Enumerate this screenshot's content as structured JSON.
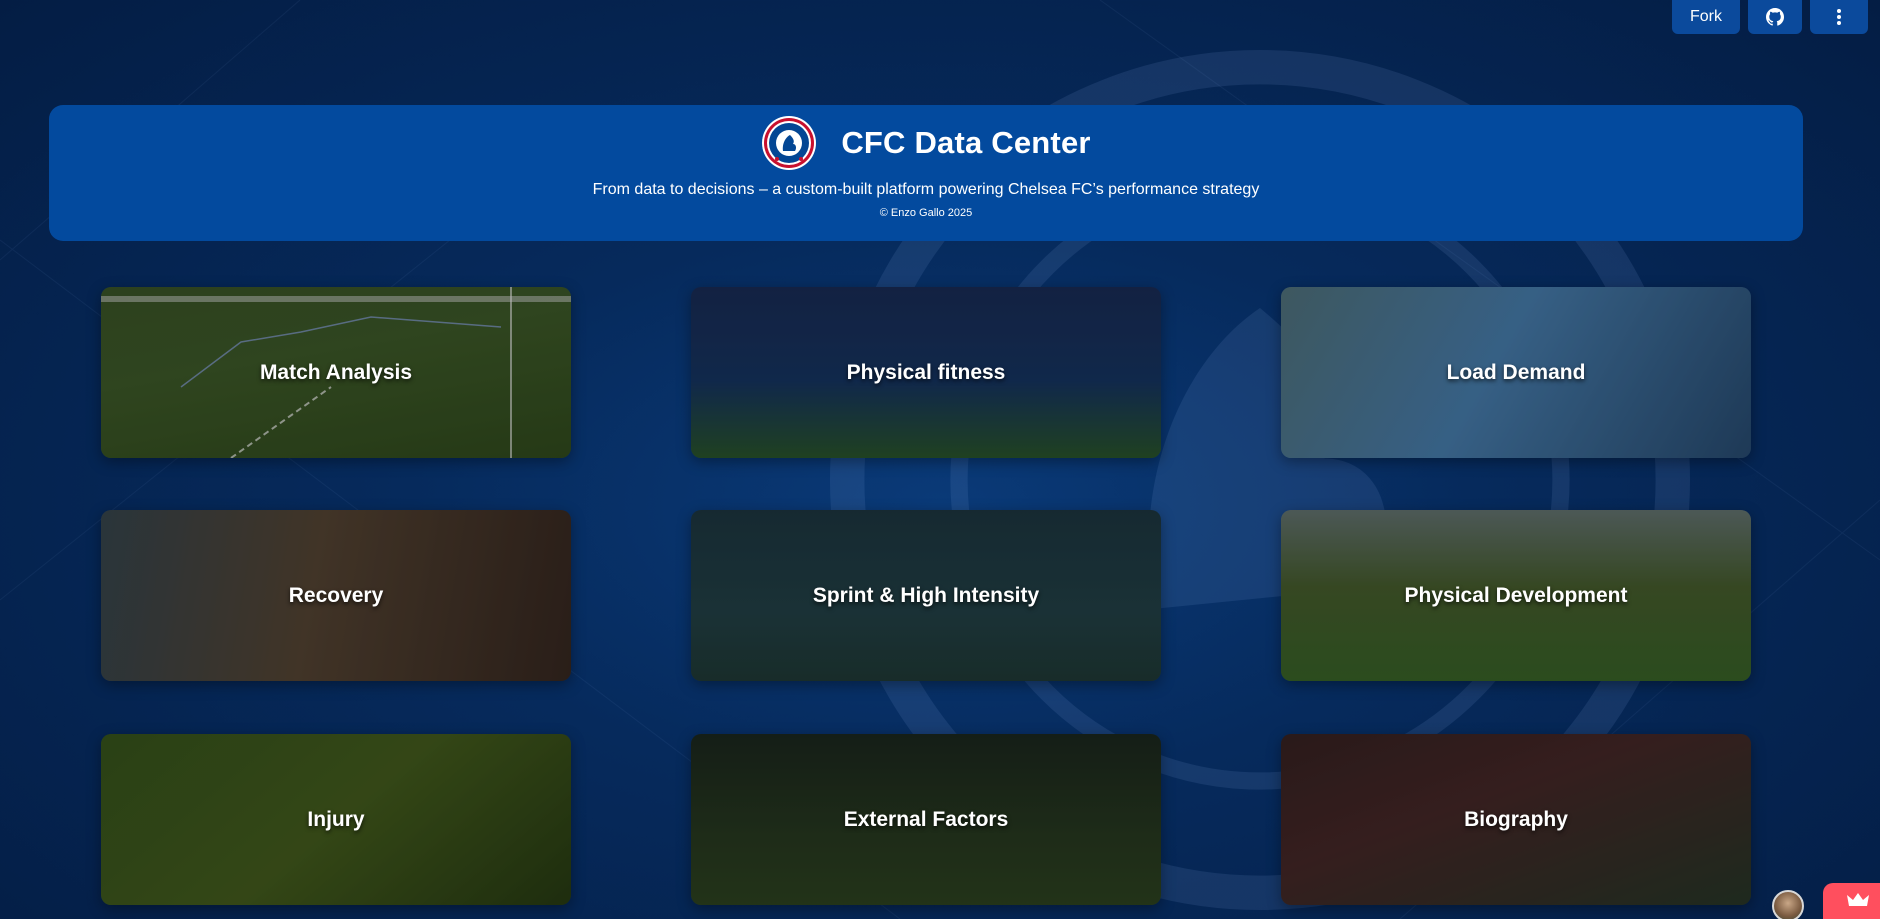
{
  "topbar": {
    "fork_label": "Fork",
    "github_icon": "github-icon",
    "menu_icon": "more-vertical-icon"
  },
  "header": {
    "logo": "chelsea-crest-icon",
    "title": "CFC Data Center",
    "subtitle": "From data to decisions – a custom-built platform powering Chelsea FC’s performance strategy",
    "copyright": "© Enzo Gallo 2025"
  },
  "tiles": [
    {
      "label": "Match Analysis"
    },
    {
      "label": "Physical fitness"
    },
    {
      "label": "Load Demand"
    },
    {
      "label": "Recovery"
    },
    {
      "label": "Sprint & High Intensity"
    },
    {
      "label": "Physical Development"
    },
    {
      "label": "Injury"
    },
    {
      "label": "External Factors"
    },
    {
      "label": "Biography"
    }
  ],
  "widgets": {
    "avatar": "user-avatar",
    "crown_icon": "crown-icon"
  },
  "colors": {
    "background": "#041d44",
    "header_card": "#034a9e",
    "button": "#0b4a9c",
    "crown_button": "#ff4f5e"
  }
}
